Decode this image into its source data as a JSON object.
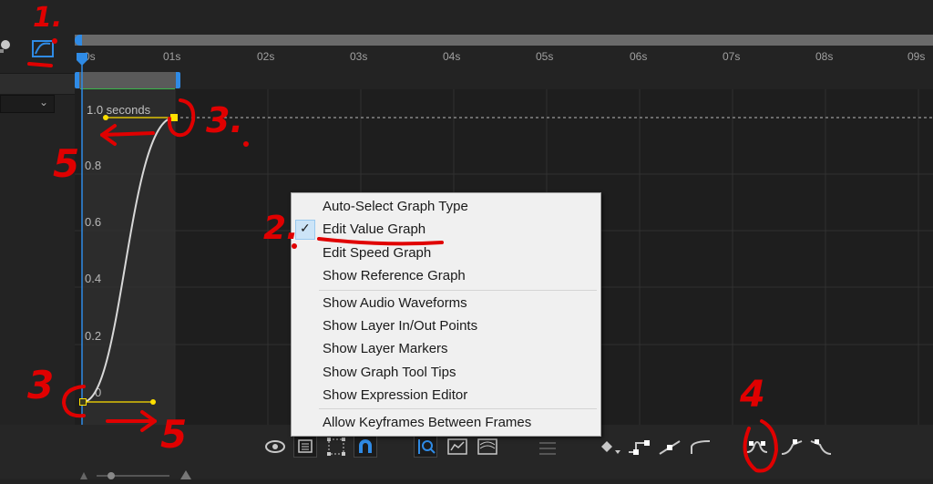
{
  "timeline": {
    "ruler_labels": [
      "0s",
      "01s",
      "02s",
      "03s",
      "04s",
      "05s",
      "06s",
      "07s",
      "08s",
      "09s"
    ]
  },
  "graph": {
    "duration_label": "1.0 seconds",
    "y_ticks": [
      "0.8",
      "0.6",
      "0.4",
      "0.2",
      "0"
    ]
  },
  "context_menu": {
    "items": [
      {
        "label": "Auto-Select Graph Type",
        "checked": false
      },
      {
        "label": "Edit Value Graph",
        "checked": true
      },
      {
        "label": "Edit Speed Graph",
        "checked": false
      },
      {
        "label": "Show Reference Graph",
        "checked": false
      },
      {
        "label": "Show Audio Waveforms",
        "checked": false
      },
      {
        "label": "Show Layer In/Out Points",
        "checked": false
      },
      {
        "label": "Show Layer Markers",
        "checked": false
      },
      {
        "label": "Show Graph Tool Tips",
        "checked": false
      },
      {
        "label": "Show Expression Editor",
        "checked": false
      },
      {
        "label": "Allow Keyframes Between Frames",
        "checked": false
      }
    ]
  },
  "annotations": [
    "1.",
    "2.",
    "3.",
    "3",
    "4",
    "5",
    "5"
  ],
  "colors": {
    "accent_blue": "#2f8be6",
    "keyframe_yellow": "#ffe000",
    "annotation_red": "#e00000",
    "work_area_green": "#39b54a"
  },
  "icons": {
    "graph_editor_toggle": "graph-editor-icon",
    "eye": "eye-icon",
    "graph_options": "graph-options-icon",
    "transform_box": "transform-box-icon",
    "snap": "snap-magnet-icon",
    "auto_zoom": "auto-zoom-icon",
    "fit_selection": "fit-selection-icon",
    "fit_all": "fit-all-icon",
    "separate_dimensions": "separate-dimensions-icon",
    "edit_keyframe": "edit-keyframe-icon",
    "hold": "hold-keyframe-icon",
    "auto_bezier": "auto-bezier-icon",
    "easy_ease": "easy-ease-icon",
    "easy_ease_in": "easy-ease-in-icon",
    "easy_ease_out": "easy-ease-out-icon"
  }
}
